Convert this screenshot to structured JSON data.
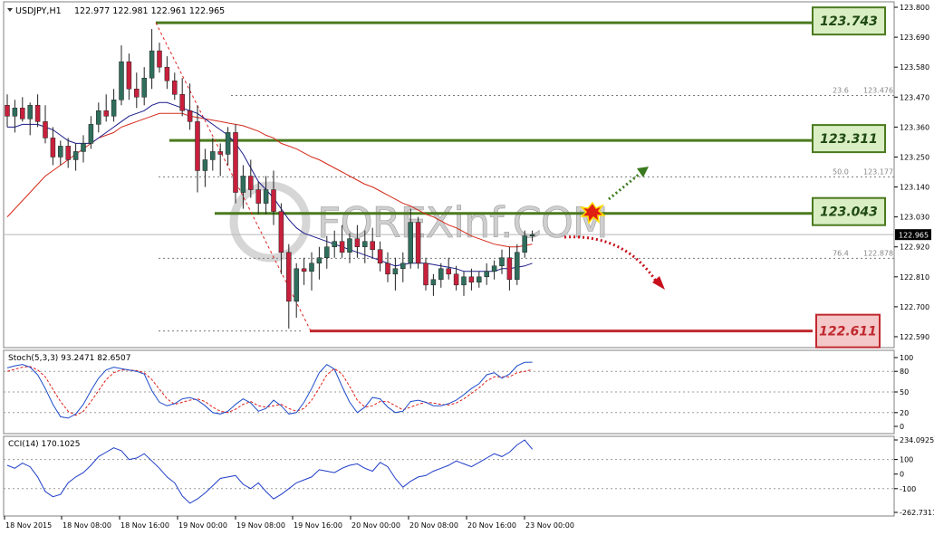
{
  "header": {
    "symbol": "USDJPY,H1",
    "ohlc": "122.977 122.981 122.961 122.965"
  },
  "watermark": "FOREXinf.COM",
  "colors": {
    "support": "#c0282e",
    "resistance": "#4a7a1e",
    "bull": "#2f6e5c",
    "bear": "#c8203c",
    "ma_fast": "#1a1a8c",
    "ma_slow": "#d42a1a",
    "stoch_main": "#1e4cc8",
    "stoch_signal": "#e0201a",
    "cci": "#1e3cc8"
  },
  "chart_data": [
    {
      "type": "candlestick",
      "title": "USDJPY,H1",
      "ylim": [
        122.55,
        123.82
      ],
      "y_ticks": [
        "123.800",
        "123.690",
        "123.580",
        "123.470",
        "123.360",
        "123.250",
        "123.140",
        "123.030",
        "122.920",
        "122.810",
        "122.700",
        "122.590"
      ],
      "x_ticks": [
        "18 Nov 2015",
        "18 Nov 08:00",
        "18 Nov 16:00",
        "19 Nov 00:00",
        "19 Nov 08:00",
        "19 Nov 16:00",
        "20 Nov 00:00",
        "20 Nov 08:00",
        "20 Nov 16:00",
        "23 Nov 00:00"
      ],
      "current_price": "122.965",
      "levels": [
        {
          "label": "123.743",
          "value": 123.743,
          "kind": "resistance"
        },
        {
          "label": "123.311",
          "value": 123.311,
          "kind": "resistance"
        },
        {
          "label": "123.043",
          "value": 123.043,
          "kind": "resistance"
        },
        {
          "label": "122.611",
          "value": 122.611,
          "kind": "support"
        }
      ],
      "fibonacci": [
        {
          "ratio": "23.6",
          "price": "123.476"
        },
        {
          "ratio": "50.0",
          "price": "123.177"
        },
        {
          "ratio": "76.4",
          "price": "122.878"
        }
      ],
      "candles": [
        [
          123.44,
          123.48,
          123.36,
          123.4
        ],
        [
          123.4,
          123.46,
          123.34,
          123.43
        ],
        [
          123.43,
          123.47,
          123.38,
          123.39
        ],
        [
          123.39,
          123.45,
          123.33,
          123.44
        ],
        [
          123.44,
          123.48,
          123.36,
          123.38
        ],
        [
          123.38,
          123.44,
          123.3,
          123.32
        ],
        [
          123.32,
          123.36,
          123.22,
          123.25
        ],
        [
          123.25,
          123.31,
          123.22,
          123.29
        ],
        [
          123.29,
          123.32,
          123.21,
          123.24
        ],
        [
          123.24,
          123.3,
          123.2,
          123.27
        ],
        [
          123.27,
          123.33,
          123.23,
          123.3
        ],
        [
          123.3,
          123.4,
          123.28,
          123.37
        ],
        [
          123.37,
          123.45,
          123.34,
          123.42
        ],
        [
          123.42,
          123.48,
          123.38,
          123.4
        ],
        [
          123.4,
          123.5,
          123.38,
          123.46
        ],
        [
          123.46,
          123.66,
          123.44,
          123.6
        ],
        [
          123.6,
          123.63,
          123.46,
          123.5
        ],
        [
          123.5,
          123.56,
          123.43,
          123.47
        ],
        [
          123.47,
          123.58,
          123.44,
          123.54
        ],
        [
          123.54,
          123.72,
          123.5,
          123.64
        ],
        [
          123.64,
          123.67,
          123.56,
          123.58
        ],
        [
          123.58,
          123.62,
          123.5,
          123.53
        ],
        [
          123.53,
          123.56,
          123.46,
          123.48
        ],
        [
          123.48,
          123.54,
          123.4,
          123.42
        ],
        [
          123.42,
          123.52,
          123.35,
          123.38
        ],
        [
          123.38,
          123.44,
          123.12,
          123.2
        ],
        [
          123.2,
          123.28,
          123.14,
          123.24
        ],
        [
          123.24,
          123.32,
          123.2,
          123.27
        ],
        [
          123.27,
          123.3,
          123.18,
          123.26
        ],
        [
          123.26,
          123.36,
          123.22,
          123.34
        ],
        [
          123.34,
          123.37,
          123.08,
          123.12
        ],
        [
          123.12,
          123.22,
          123.06,
          123.18
        ],
        [
          123.18,
          123.24,
          123.1,
          123.13
        ],
        [
          123.13,
          123.16,
          123.04,
          123.08
        ],
        [
          123.08,
          123.18,
          123.04,
          123.13
        ],
        [
          123.13,
          123.2,
          123.0,
          123.05
        ],
        [
          123.05,
          123.08,
          122.82,
          122.9
        ],
        [
          122.9,
          122.93,
          122.62,
          122.72
        ],
        [
          122.72,
          122.86,
          122.66,
          122.84
        ],
        [
          122.84,
          122.88,
          122.78,
          122.83
        ],
        [
          122.83,
          122.9,
          122.76,
          122.86
        ],
        [
          122.86,
          122.92,
          122.8,
          122.88
        ],
        [
          122.88,
          122.96,
          122.84,
          122.92
        ],
        [
          122.92,
          122.98,
          122.88,
          122.94
        ],
        [
          122.94,
          123.0,
          122.88,
          122.9
        ],
        [
          122.9,
          122.97,
          122.86,
          122.95
        ],
        [
          122.95,
          123.0,
          122.88,
          122.92
        ],
        [
          122.92,
          122.98,
          122.86,
          122.94
        ],
        [
          122.94,
          122.99,
          122.88,
          122.91
        ],
        [
          122.91,
          122.94,
          122.83,
          122.86
        ],
        [
          122.86,
          122.9,
          122.79,
          122.82
        ],
        [
          122.82,
          122.88,
          122.76,
          122.84
        ],
        [
          122.84,
          122.9,
          122.79,
          122.86
        ],
        [
          122.86,
          123.06,
          122.84,
          123.01
        ],
        [
          123.01,
          123.03,
          122.84,
          122.86
        ],
        [
          122.86,
          122.88,
          122.76,
          122.78
        ],
        [
          122.78,
          122.82,
          122.74,
          122.8
        ],
        [
          122.8,
          122.86,
          122.77,
          122.84
        ],
        [
          122.84,
          122.88,
          122.8,
          122.82
        ],
        [
          122.82,
          122.85,
          122.76,
          122.78
        ],
        [
          122.78,
          122.83,
          122.74,
          122.81
        ],
        [
          122.81,
          122.84,
          122.76,
          122.79
        ],
        [
          122.79,
          122.83,
          122.77,
          122.81
        ],
        [
          122.81,
          122.86,
          122.78,
          122.83
        ],
        [
          122.83,
          122.87,
          122.8,
          122.85
        ],
        [
          122.85,
          122.91,
          122.82,
          122.88
        ],
        [
          122.88,
          122.92,
          122.76,
          122.8
        ],
        [
          122.8,
          122.93,
          122.78,
          122.9
        ],
        [
          122.9,
          122.98,
          122.88,
          122.96
        ],
        [
          122.96,
          122.98,
          122.94,
          122.965
        ]
      ],
      "ma_fast": [
        123.36,
        123.36,
        123.37,
        123.37,
        123.37,
        123.36,
        123.35,
        123.33,
        123.31,
        123.3,
        123.3,
        123.3,
        123.32,
        123.34,
        123.36,
        123.38,
        123.4,
        123.41,
        123.42,
        123.44,
        123.45,
        123.45,
        123.44,
        123.43,
        123.42,
        123.41,
        123.39,
        123.37,
        123.35,
        123.33,
        123.3,
        123.26,
        123.21,
        123.16,
        123.13,
        123.1,
        123.06,
        123.02,
        122.99,
        122.97,
        122.96,
        122.95,
        122.94,
        122.93,
        122.92,
        122.91,
        122.9,
        122.89,
        122.88,
        122.87,
        122.86,
        122.85,
        122.855,
        122.86,
        122.86,
        122.86,
        122.855,
        122.85,
        122.845,
        122.84,
        122.83,
        122.83,
        122.83,
        122.83,
        122.83,
        122.84,
        122.84,
        122.845,
        122.85,
        122.86
      ],
      "ma_slow": [
        123.03,
        123.06,
        123.09,
        123.12,
        123.15,
        123.18,
        123.2,
        123.22,
        123.24,
        123.26,
        123.28,
        123.3,
        123.32,
        123.33,
        123.34,
        123.36,
        123.37,
        123.38,
        123.39,
        123.4,
        123.41,
        123.41,
        123.41,
        123.41,
        123.4,
        123.395,
        123.39,
        123.385,
        123.38,
        123.375,
        123.37,
        123.365,
        123.355,
        123.345,
        123.33,
        123.32,
        123.3,
        123.29,
        123.28,
        123.265,
        123.25,
        123.24,
        123.225,
        123.21,
        123.195,
        123.18,
        123.165,
        123.15,
        123.14,
        123.125,
        123.11,
        123.095,
        123.08,
        123.07,
        123.055,
        123.04,
        123.03,
        123.015,
        123.0,
        122.99,
        122.975,
        122.96,
        122.95,
        122.94,
        122.93,
        122.925,
        122.92,
        122.92,
        122.925,
        122.93
      ]
    },
    {
      "type": "line",
      "title": "Stoch(5,3,3) 93.2471 82.6507",
      "ylim": [
        0,
        100
      ],
      "y_ticks": [
        "100",
        "80",
        "50",
        "20",
        "0"
      ],
      "series": [
        {
          "values": [
            85,
            88,
            90,
            86,
            75,
            55,
            32,
            14,
            12,
            18,
            32,
            52,
            70,
            82,
            86,
            84,
            82,
            80,
            76,
            52,
            35,
            30,
            33,
            40,
            42,
            38,
            30,
            20,
            18,
            22,
            32,
            40,
            34,
            22,
            26,
            38,
            30,
            18,
            20,
            35,
            55,
            78,
            90,
            83,
            58,
            35,
            20,
            28,
            42,
            40,
            28,
            20,
            22,
            36,
            38,
            35,
            30,
            30,
            33,
            38,
            46,
            55,
            62,
            75,
            78,
            70,
            76,
            88,
            93,
            93.2471
          ]
        },
        {
          "values": [
            80,
            83,
            86,
            87,
            82,
            72,
            54,
            36,
            22,
            16,
            22,
            36,
            52,
            68,
            78,
            82,
            82,
            81,
            78,
            68,
            54,
            40,
            32,
            35,
            38,
            40,
            36,
            28,
            22,
            20,
            25,
            32,
            36,
            30,
            28,
            30,
            32,
            26,
            22,
            26,
            38,
            56,
            75,
            84,
            76,
            58,
            38,
            28,
            30,
            36,
            36,
            30,
            24,
            28,
            32,
            35,
            34,
            32,
            31,
            34,
            40,
            48,
            56,
            66,
            72,
            72,
            72,
            78,
            80,
            82.6507
          ]
        }
      ]
    },
    {
      "type": "line",
      "title": "CCI(14) 170.1025",
      "ylim": [
        -262.7311,
        234.0925
      ],
      "y_ticks": [
        "234.0925",
        "100",
        "0",
        "-100",
        "-262.7311"
      ],
      "series": [
        {
          "values": [
            60,
            40,
            75,
            50,
            -20,
            -120,
            -155,
            -140,
            -60,
            -20,
            10,
            60,
            120,
            150,
            180,
            160,
            100,
            110,
            140,
            90,
            40,
            -20,
            -60,
            -150,
            -200,
            -170,
            -130,
            -80,
            -30,
            -20,
            -10,
            -70,
            -100,
            -60,
            -120,
            -170,
            -140,
            -100,
            -60,
            -40,
            -20,
            30,
            20,
            10,
            40,
            60,
            70,
            40,
            20,
            80,
            50,
            -30,
            -90,
            -50,
            -20,
            -10,
            20,
            40,
            60,
            90,
            70,
            50,
            80,
            110,
            140,
            120,
            150,
            200,
            234.0925,
            170.1025
          ]
        }
      ]
    }
  ]
}
